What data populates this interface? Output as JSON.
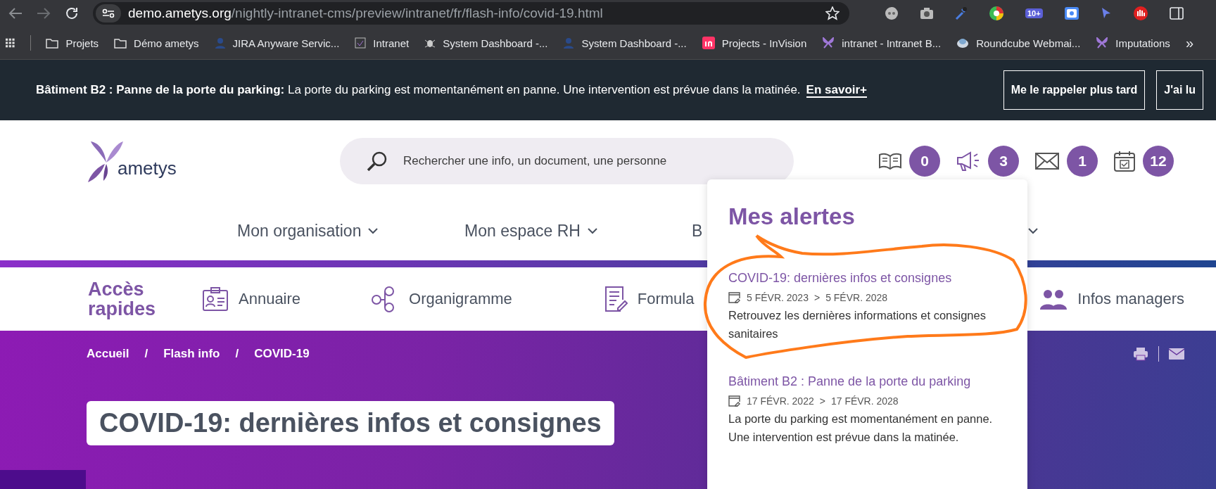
{
  "browser": {
    "url_host": "demo.ametys.org",
    "url_path": "/nightly-intranet-cms/preview/intranet/fr/flash-info/covid-19.html",
    "extension_badge": "10+",
    "bookmarks": [
      {
        "kind": "folder",
        "label": "Projets"
      },
      {
        "kind": "folder",
        "label": "Démo ametys"
      },
      {
        "kind": "jira",
        "label": "JIRA Anyware Servic..."
      },
      {
        "kind": "page",
        "label": "Intranet"
      },
      {
        "kind": "dashboard",
        "label": "System Dashboard -..."
      },
      {
        "kind": "jira",
        "label": "System Dashboard -..."
      },
      {
        "kind": "invision",
        "label": "Projects - InVision"
      },
      {
        "kind": "butterfly",
        "label": "intranet - Intranet B..."
      },
      {
        "kind": "cloud",
        "label": "Roundcube Webmai..."
      },
      {
        "kind": "butterfly",
        "label": "Imputations"
      }
    ],
    "more": "»"
  },
  "banner": {
    "message": "**Bâtiment B2 : Panne de la porte du parking:** La porte du parking est momentanément en panne. Une intervention est prévue dans la matinée.",
    "link": "En savoir+",
    "buttons": [
      "Me le rappeler plus tard",
      "J'ai lu"
    ]
  },
  "header": {
    "logo": "ametys",
    "search": {
      "placeholder": "Rechercher une info, un document, une personne"
    },
    "counters": [
      {
        "kind": "book",
        "count": "0"
      },
      {
        "kind": "megaphone",
        "count": "3"
      },
      {
        "kind": "mail",
        "count": "1"
      },
      {
        "kind": "calendar",
        "count": "12"
      }
    ]
  },
  "nav": {
    "items": [
      "Mon organisation",
      "Mon espace RH",
      "B"
    ]
  },
  "quick_access": {
    "title": "Accès rapides",
    "items": [
      {
        "kind": "directory",
        "label": "Annuaire"
      },
      {
        "kind": "org-chart",
        "label": "Organigramme"
      },
      {
        "kind": "form",
        "label": "Formula"
      },
      {
        "kind": "managers",
        "label": "Infos managers"
      }
    ]
  },
  "breadcrumb": [
    {
      "label": "Accueil",
      "separator": "/"
    },
    {
      "label": "Flash info",
      "separator": "/"
    },
    {
      "label": "COVID-19"
    }
  ],
  "page_title": "COVID-19: dernières infos et consignes",
  "alerts_panel": {
    "title": "Mes alertes",
    "alerts": [
      {
        "title": "COVID-19: dernières infos et consignes",
        "start": "5 FÉVR. 2023",
        "separator": ">",
        "end": "5 FÉVR. 2028",
        "description": "Retrouvez les dernières informations et consignes sanitaires"
      },
      {
        "title": "Bâtiment B2 : Panne de la porte du parking",
        "start": "17 FÉVR. 2022",
        "separator": ">",
        "end": "17 FÉVR. 2028",
        "description": "La porte du parking est momentanément en panne. Une intervention est prévue dans la matinée."
      }
    ]
  }
}
